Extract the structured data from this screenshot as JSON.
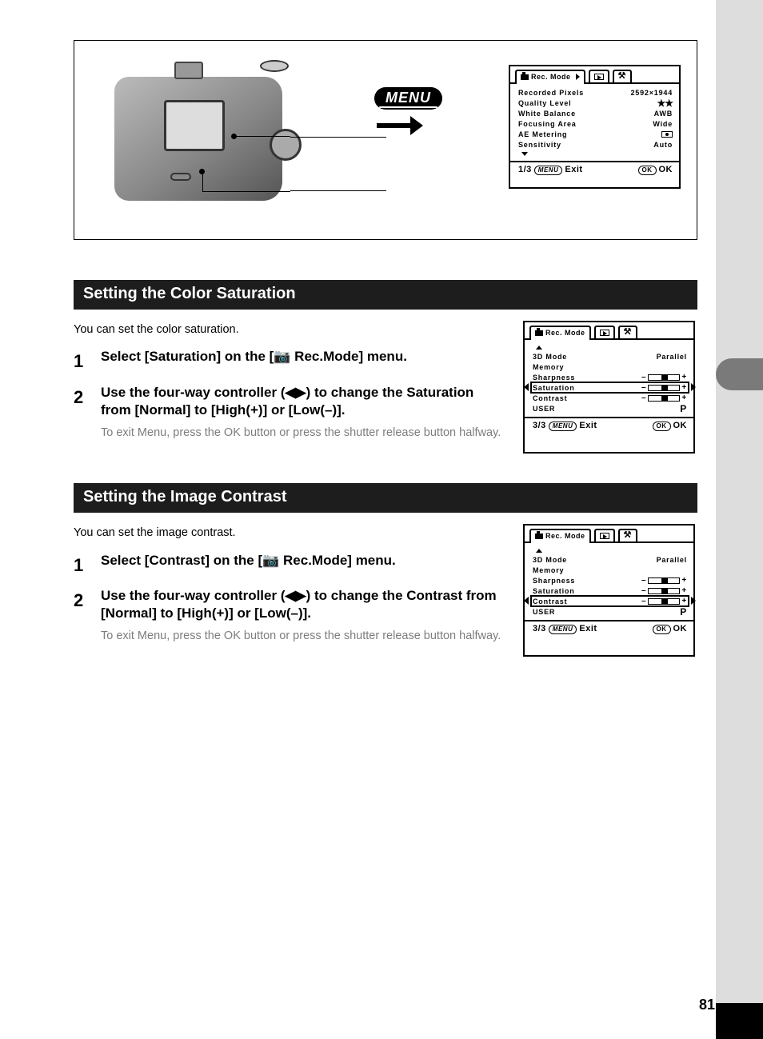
{
  "menu_button": "MENU",
  "lcd1": {
    "tab_label": "Rec. Mode",
    "rows": [
      {
        "label": "Recorded Pixels",
        "value": "2592×1944"
      },
      {
        "label": "Quality Level",
        "value": "★★"
      },
      {
        "label": "White Balance",
        "value": "AWB"
      },
      {
        "label": "Focusing Area",
        "value": "Wide"
      },
      {
        "label": "AE Metering",
        "value": ""
      },
      {
        "label": "Sensitivity",
        "value": "Auto"
      }
    ],
    "page": "1/3",
    "exit": "Exit",
    "ok": "OK",
    "menu": "MENU",
    "ok_badge": "OK"
  },
  "section1": {
    "heading": "Setting the Color Saturation",
    "intro": "You can set the color saturation.",
    "step1_n": "1",
    "step1_title": "Select [Saturation] on the [📷 Rec.Mode] menu.",
    "step2_n": "2",
    "step2_title": "Use the four-way controller (◀▶) to change the Saturation from [Normal] to [High(+)] or [Low(–)].",
    "step2_body": "To exit Menu, press the OK button or press the shutter release button halfway."
  },
  "lcd2": {
    "tab_label": "Rec. Mode",
    "rows_top": [
      {
        "label": "3D Mode",
        "value": "Parallel"
      },
      {
        "label": "Memory",
        "value": ""
      }
    ],
    "rows_sliders": [
      {
        "label": "Sharpness"
      },
      {
        "label": "Saturation",
        "selected": true
      },
      {
        "label": "Contrast"
      }
    ],
    "user_row": {
      "label": "USER",
      "value": "P"
    },
    "page": "3/3",
    "exit": "Exit",
    "ok": "OK",
    "menu": "MENU",
    "ok_badge": "OK"
  },
  "section2": {
    "heading": "Setting the Image Contrast",
    "intro": "You can set the image contrast.",
    "step1_n": "1",
    "step1_title": "Select [Contrast] on the [📷 Rec.Mode] menu.",
    "step2_n": "2",
    "step2_title": "Use the four-way controller (◀▶) to change the Contrast from [Normal] to [High(+)] or [Low(–)].",
    "step2_body": "To exit Menu, press the OK button or press the shutter release button halfway."
  },
  "lcd3": {
    "tab_label": "Rec. Mode",
    "rows_top": [
      {
        "label": "3D Mode",
        "value": "Parallel"
      },
      {
        "label": "Memory",
        "value": ""
      }
    ],
    "rows_sliders": [
      {
        "label": "Sharpness"
      },
      {
        "label": "Saturation"
      },
      {
        "label": "Contrast",
        "selected": true
      }
    ],
    "user_row": {
      "label": "USER",
      "value": "P"
    },
    "page": "3/3",
    "exit": "Exit",
    "ok": "OK",
    "menu": "MENU",
    "ok_badge": "OK"
  },
  "page_number": "81"
}
